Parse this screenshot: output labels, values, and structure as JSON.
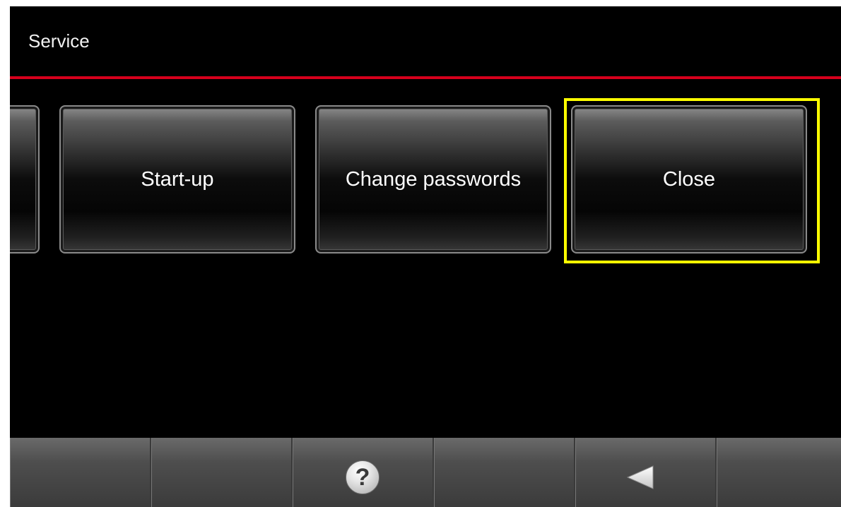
{
  "header": {
    "title": "Service"
  },
  "tiles": {
    "startup_label": "Start-up",
    "change_passwords_label": "Change passwords",
    "close_label": "Close"
  },
  "bottom_bar": {
    "help_glyph": "?",
    "help_icon": "help-icon",
    "back_icon": "back-arrow-icon"
  },
  "colors": {
    "background": "#000000",
    "header_rule": "#d6001c",
    "focus_highlight": "#ffff00",
    "bar": "#4e4e4e"
  }
}
